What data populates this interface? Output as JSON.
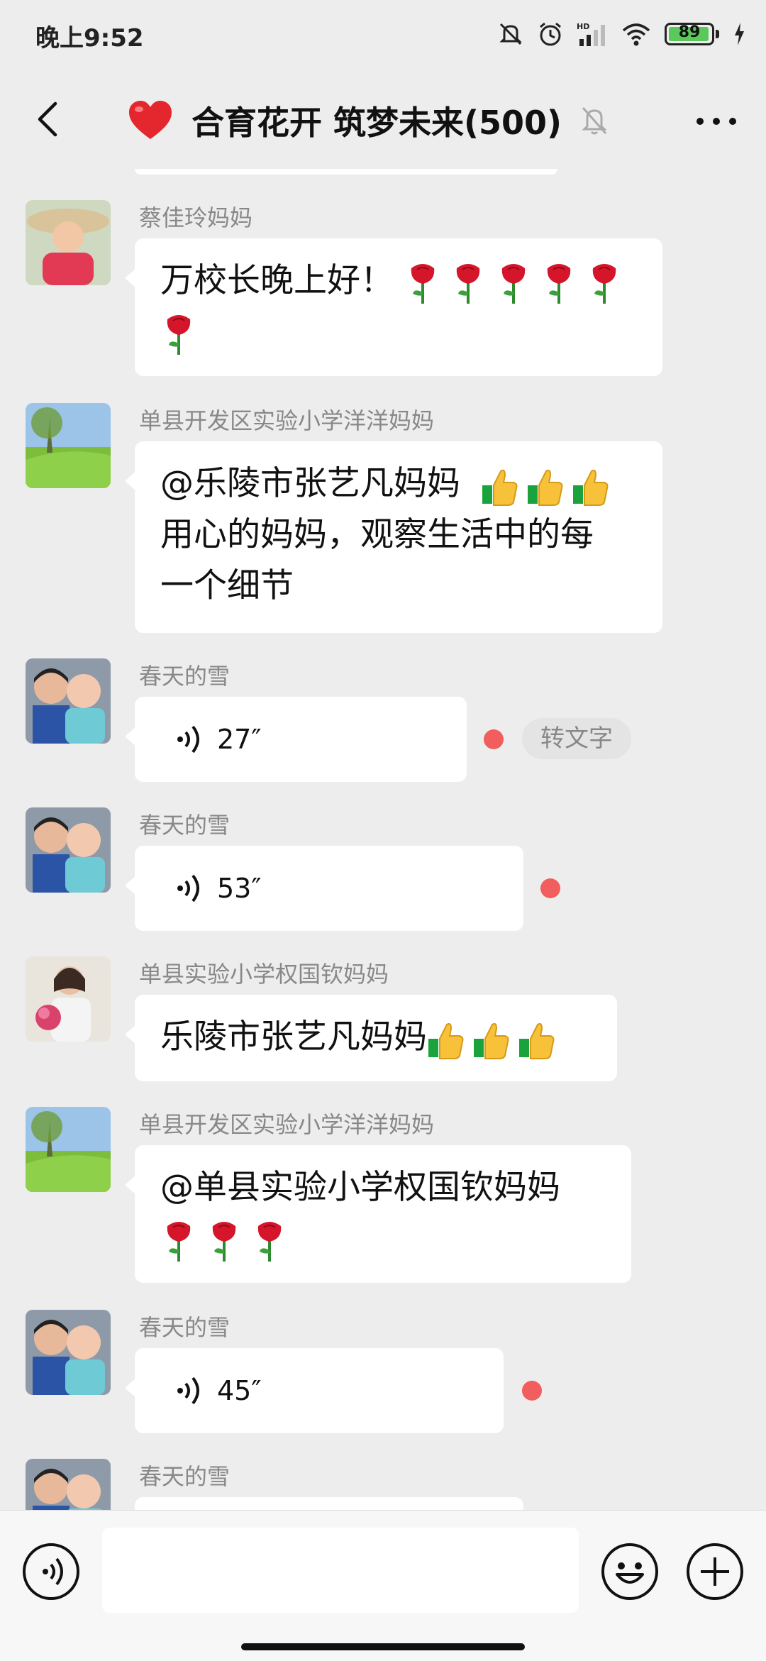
{
  "status_bar": {
    "time": "晚上9:52",
    "battery_level": "89",
    "network": "HD",
    "icons": [
      "mute-icon",
      "alarm-icon",
      "signal-icon",
      "wifi-icon",
      "battery-icon",
      "charging-icon"
    ]
  },
  "header": {
    "group_icon": "red-heart-icon",
    "title": "合育花开 筑梦未来(500)",
    "muted": true
  },
  "messages": [
    {
      "sender": "蔡佳玲妈妈",
      "type": "text",
      "text": "万校长晚上好！",
      "emoji": "rose",
      "emoji_count": 6
    },
    {
      "sender": "单县开发区实验小学洋洋妈妈",
      "type": "text",
      "line1": "@乐陵市张艺凡妈妈",
      "line2": "用心的妈妈，观察生活中的每",
      "line3": "一个细节",
      "emoji": "thumbs-up",
      "emoji_count": 3
    },
    {
      "sender": "春天的雪",
      "type": "voice",
      "duration": "27″",
      "unread": true,
      "convert_label": "转文字"
    },
    {
      "sender": "春天的雪",
      "type": "voice",
      "duration": "53″",
      "unread": true
    },
    {
      "sender": "单县实验小学权国钦妈妈",
      "type": "text",
      "text": "乐陵市张艺凡妈妈",
      "emoji": "thumbs-up",
      "emoji_count": 3
    },
    {
      "sender": "单县开发区实验小学洋洋妈妈",
      "type": "text",
      "text": "@单县实验小学权国钦妈妈",
      "emoji": "rose",
      "emoji_count": 3
    },
    {
      "sender": "春天的雪",
      "type": "voice",
      "duration": "45″",
      "unread": true
    },
    {
      "sender": "春天的雪",
      "type": "voice",
      "partial": true
    }
  ],
  "input_bar": {
    "left_button": "voice-input-icon",
    "right_buttons": [
      "emoji-icon",
      "plus-icon"
    ]
  },
  "colors": {
    "background": "#ededed",
    "bubble": "#ffffff",
    "unread_dot": "#f25d5d",
    "sender_text": "#888888"
  }
}
